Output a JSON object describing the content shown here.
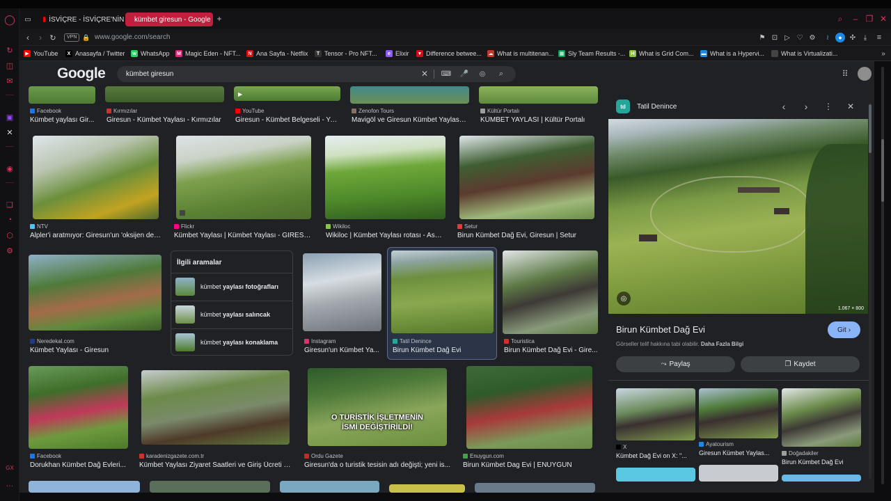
{
  "tabs": [
    {
      "label": "İSVİÇRE - İSVİÇRE'NİN İZ",
      "color": "#ff0000"
    },
    {
      "label": "kümbet giresun - Google",
      "color": "#ffffff"
    }
  ],
  "address": {
    "vpn": "VPN",
    "url": "www.google.com/search"
  },
  "bookmarks": [
    {
      "label": "YouTube",
      "color": "#ff0000",
      "icon": "youtube-icon"
    },
    {
      "label": "Anasayfa / Twitter",
      "color": "#000000",
      "icon": "x-icon"
    },
    {
      "label": "WhatsApp",
      "color": "#25d366",
      "icon": "whatsapp-icon"
    },
    {
      "label": "Magic Eden - NFT...",
      "color": "#e42575",
      "icon": "magic-eden-icon"
    },
    {
      "label": "Ana Sayfa - Netflix",
      "color": "#e50914",
      "icon": "netflix-icon"
    },
    {
      "label": "Tensor - Pro NFT...",
      "color": "#333333",
      "icon": "tensor-icon"
    },
    {
      "label": "Elixir",
      "color": "#8a5cf6",
      "icon": "elixir-icon"
    },
    {
      "label": "Difference betwee...",
      "color": "#d10e1e",
      "icon": "red-triangle-icon"
    },
    {
      "label": "What is multitenan...",
      "color": "#c0392b",
      "icon": "cloud-icon"
    },
    {
      "label": "Sly Team Results -...",
      "color": "#0f9d58",
      "icon": "sheets-icon"
    },
    {
      "label": "What is Grid Com...",
      "color": "#8bc34a",
      "icon": "h-icon"
    },
    {
      "label": "What is a Hypervi...",
      "color": "#1e88e5",
      "icon": "site-icon"
    },
    {
      "label": "What is Virtualizati...",
      "color": "#444444",
      "icon": "site-icon"
    }
  ],
  "google": {
    "logo": "Google",
    "query": "kümbet giresun"
  },
  "row0": [
    {
      "source": "Facebook",
      "title": "Kümbet yaylası Gir...",
      "favcolor": "#1877f2"
    },
    {
      "source": "Kırmızılar",
      "title": "Giresun - Kümbet Yaylası - Kırmızılar",
      "favcolor": "#d32f2f"
    },
    {
      "source": "YouTube",
      "title": "Giresun - Kümbet Belgeseli - Yo...",
      "favcolor": "#ff0000"
    },
    {
      "source": "Zenofon Tours",
      "title": "Mavigöl ve Giresun Kümbet Yaylası ...",
      "favcolor": "#8d6e63"
    },
    {
      "source": "Kültür Portalı",
      "title": "KÜMBET YAYLASI | Kültür Portalı",
      "favcolor": "#9e9e9e"
    }
  ],
  "row1": [
    {
      "source": "NTV",
      "title": "Alpler'i aratmıyor: Giresun'un 'oksijen dep...",
      "favcolor": "#4fc3f7"
    },
    {
      "source": "Flickr",
      "title": "Kümbet Yaylası | Kümbet Yaylası - GİRESU...",
      "favcolor": "#ff0084"
    },
    {
      "source": "Wikiloc",
      "title": "Wikiloc | Kümbet Yaylası rotası - Asar...",
      "favcolor": "#8bc34a"
    },
    {
      "source": "Setur",
      "title": "Birun Kümbet Dağ Evi, Giresun | Setur",
      "favcolor": "#e53935"
    }
  ],
  "row2": [
    {
      "source": "Neredekal.com",
      "title": "Kümbet Yaylası - Giresun",
      "favcolor": "#1e3a8a"
    },
    {
      "source": "Instagram",
      "title": "Giresun'un Kümbet Ya...",
      "favcolor": "#e1306c"
    },
    {
      "source": "Tatil Denince",
      "title": "Birun Kümbet Dağ Evi",
      "favcolor": "#26a69a"
    },
    {
      "source": "Touristica",
      "title": "Birun Kümbet Dağ Evi - Gire...",
      "favcolor": "#d32f2f"
    }
  ],
  "related": {
    "heading": "İlgili aramalar",
    "items": [
      {
        "prefix": "kümbet ",
        "bold": "yaylası fotoğrafları"
      },
      {
        "prefix": "kümbet ",
        "bold": "yaylası salıncak"
      },
      {
        "prefix": "kümbet ",
        "bold": "yaylası konaklama"
      }
    ]
  },
  "row3": [
    {
      "source": "Facebook",
      "title": "Dorukhan Kümbet Dağ Evleri...",
      "favcolor": "#1877f2"
    },
    {
      "source": "karadenizgazete.com.tr",
      "title": "Kümbet Yaylası Ziyaret Saatleri ve Giriş Ücreti | ...",
      "favcolor": "#d32f2f"
    },
    {
      "source": "Ordu Gazete",
      "title": "Giresun'da o turistik tesisin adı değişti; yeni is...",
      "favcolor": "#c62828"
    },
    {
      "source": "Enuygun.com",
      "title": "Birun Kümbet Dag Evi | ENUYGUN",
      "favcolor": "#43a047"
    }
  ],
  "overlay_text": {
    "line1": "O TURİSTİK İŞLETMENİN",
    "line2": "İSMİ DEĞİŞTİRİLDİ!"
  },
  "panel": {
    "site": "Tatil Denince",
    "site_logo": "td",
    "image_size": "1.067 × 800",
    "title": "Birun Kümbet Dağ Evi",
    "go_label": "Git",
    "copyright": "Görseller telif hakkına tabi olabilir.",
    "more_info": "Daha Fazla Bilgi",
    "share_label": "Paylaş",
    "save_label": "Kaydet",
    "similar": [
      {
        "source": "X",
        "title": "Kümbet Dağ Evi on X: \"...",
        "favcolor": "#000000"
      },
      {
        "source": "Ayatourism",
        "title": "Giresun Kümbet Yaylas...",
        "favcolor": "#1e88e5"
      },
      {
        "source": "Doğadakiler",
        "title": "Birun Kümbet Dağ Evi",
        "favcolor": "#9e9e9e"
      }
    ]
  }
}
